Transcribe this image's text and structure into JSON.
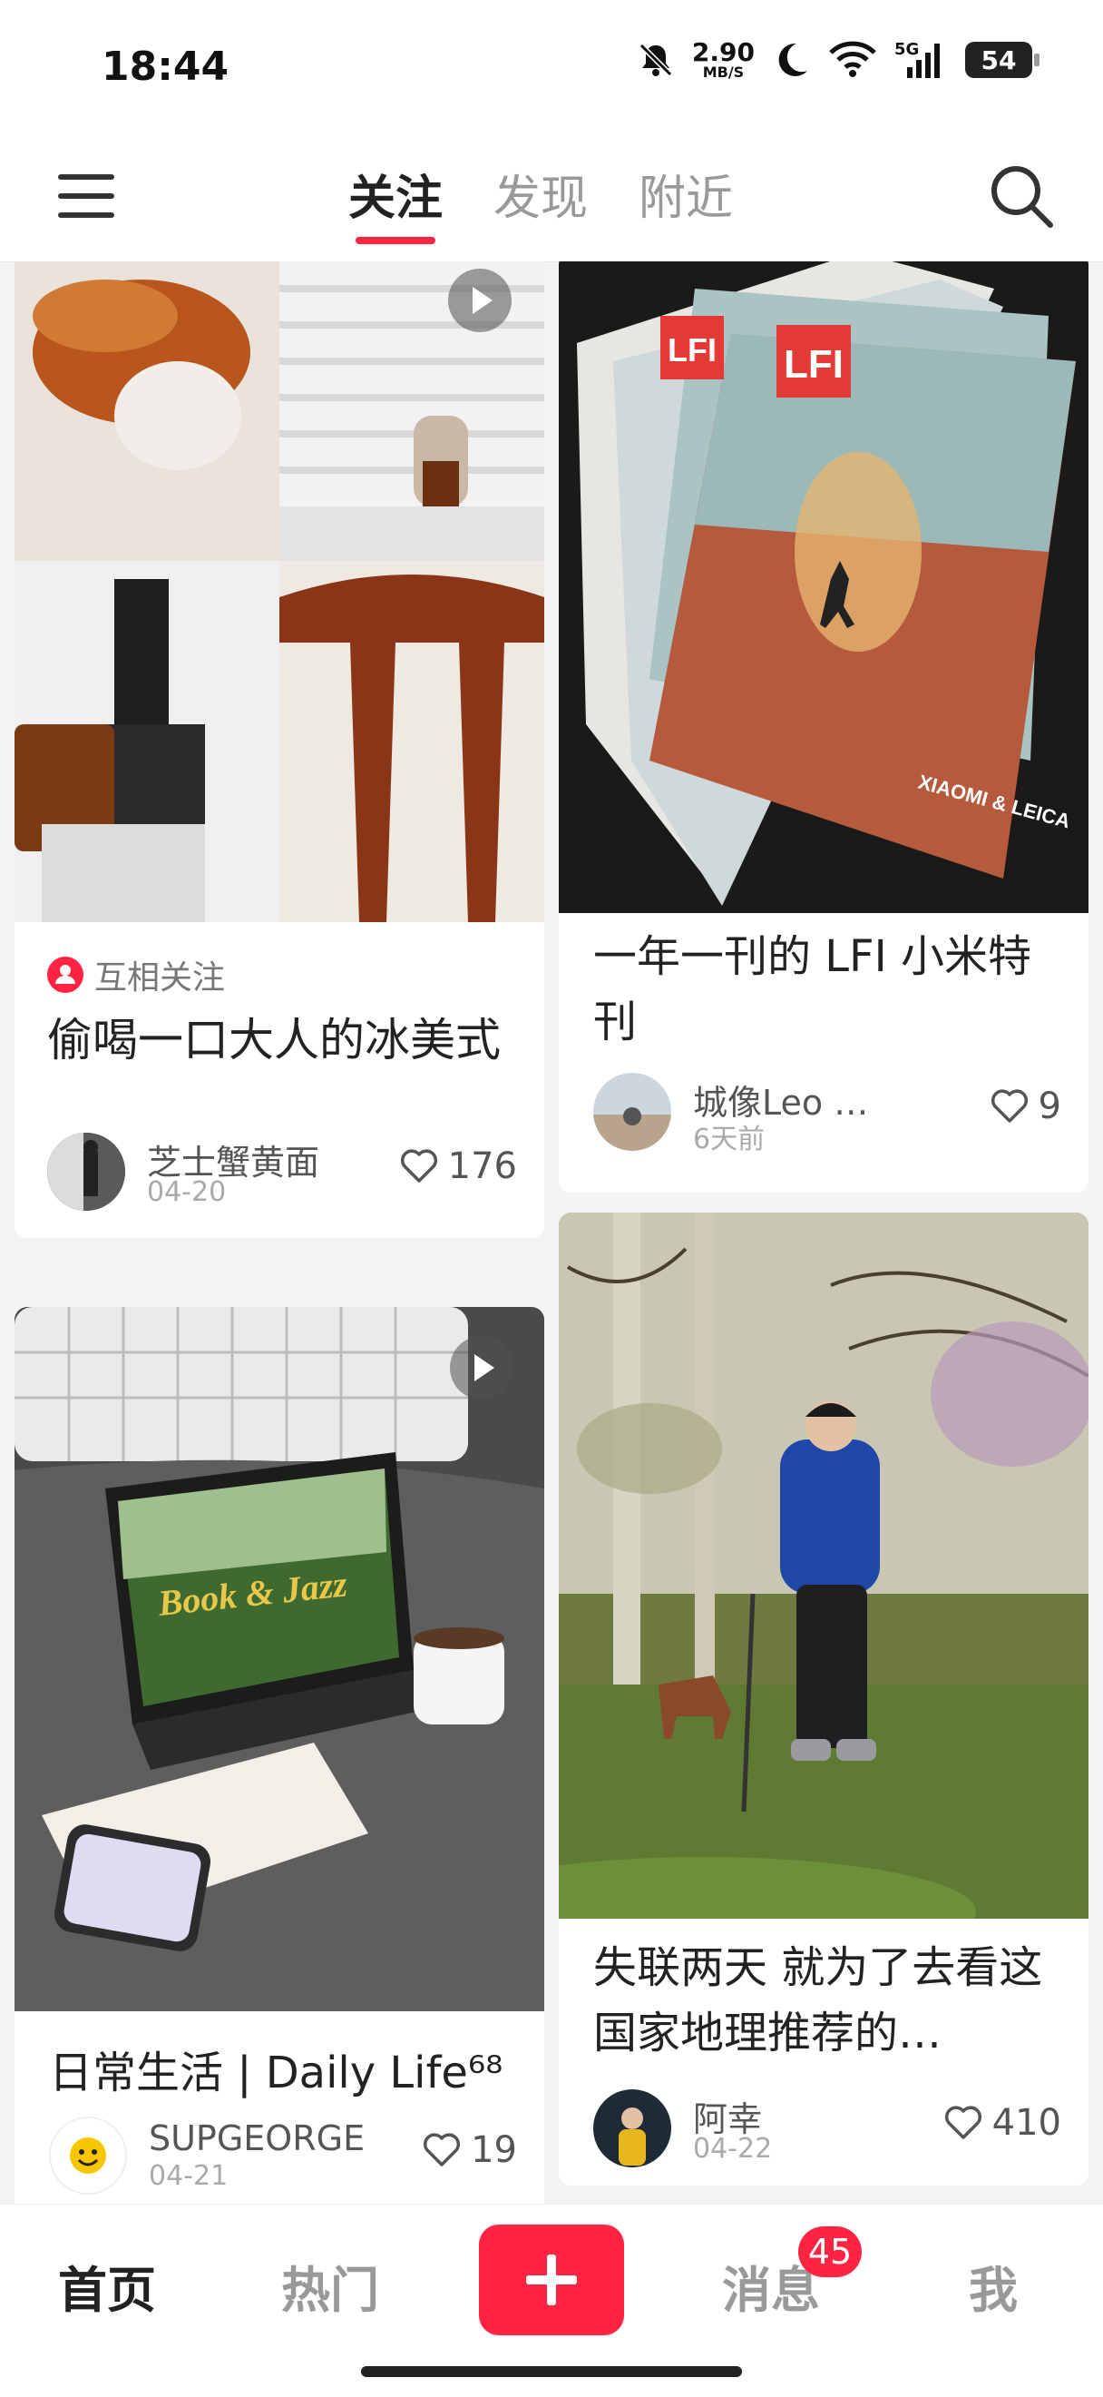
{
  "status": {
    "time": "18:44",
    "net_speed": "2.90",
    "net_unit": "MB/S",
    "network": "5G",
    "battery": "54",
    "icons": [
      "mute-bell-icon",
      "moon-icon",
      "wifi-icon",
      "signal-icon"
    ]
  },
  "header": {
    "tabs": [
      "关注",
      "发现",
      "附近"
    ],
    "active_tab": "关注",
    "icons": [
      "menu-icon",
      "search-icon"
    ]
  },
  "feed": [
    {
      "badge": "互相关注",
      "title": "偷喝一口大人的冰美式",
      "author": "芝士蟹黄面",
      "date": "04-20",
      "likes": "176",
      "video": true
    },
    {
      "title": "一年一刊的 LFI 小米特刊",
      "author": "城像Leo …",
      "date": "6天前",
      "likes": "9",
      "image_text": [
        "LFI",
        "LFI",
        "XIAOMI & LEICA"
      ]
    },
    {
      "title": "日常生活 | Daily Life⁶⁸",
      "author": "SUPGEORGE",
      "date": "04-21",
      "likes": "19",
      "video": true,
      "image_text": [
        "Book & Jazz"
      ]
    },
    {
      "title": "失联两天 就为了去看这国家地理推荐的…",
      "author": "阿幸",
      "date": "04-22",
      "likes": "410"
    }
  ],
  "bottom_nav": {
    "items": [
      "首页",
      "热门",
      "消息",
      "我"
    ],
    "active": "首页",
    "message_badge": "45"
  },
  "colors": {
    "accent": "#ff2442"
  }
}
